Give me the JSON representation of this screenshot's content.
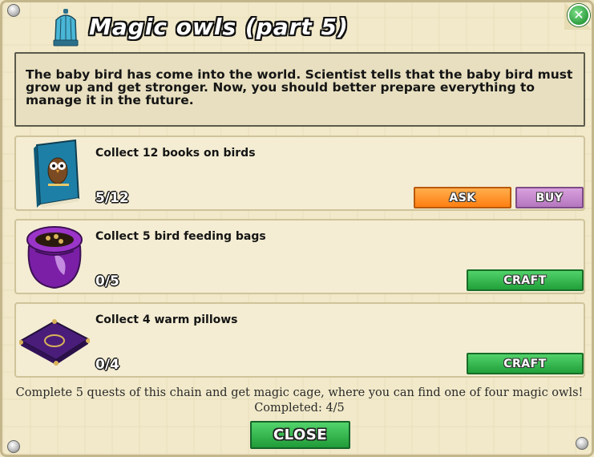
{
  "dialog": {
    "title": "Magic owls (part 5)",
    "close_icon": "close-x-icon",
    "intro": "The baby bird has come into the world. Scientist tells that the baby bird must grow up and get stronger. Now, you should better prepare everything to manage it in the future."
  },
  "quests": [
    {
      "icon": "owl-book-icon",
      "text": "Collect 12 books on birds",
      "progress": "5/12",
      "ask_label": "ASK",
      "buy_label": "BUY"
    },
    {
      "icon": "feeding-bag-icon",
      "text": "Collect 5 bird feeding bags",
      "progress": "0/5",
      "craft_label": "CRAFT"
    },
    {
      "icon": "pillow-icon",
      "text": "Collect 4 warm pillows",
      "progress": "0/4",
      "craft_label": "CRAFT"
    }
  ],
  "footer": {
    "line1": "Complete 5 quests of this chain and get magic cage, where you can find one of four magic owls!",
    "line2": "Completed: 4/5",
    "close_label": "CLOSE"
  },
  "colors": {
    "ask": "#ff8a1f",
    "buy": "#c088c8",
    "craft": "#2bb245",
    "background": "#f1e9c9"
  }
}
